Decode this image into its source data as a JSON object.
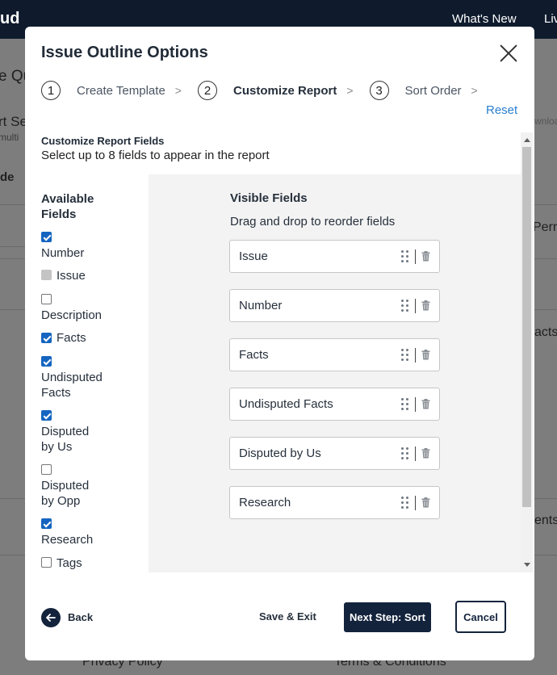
{
  "background": {
    "brand_fragment": "ud",
    "nav_whats_new": "What's New",
    "nav_fragment": "Liv",
    "fragments": [
      "e Qu",
      "rt Se",
      "multi",
      "de",
      "Perm",
      "acts,",
      "ents,",
      "wnloa",
      "Privacy Policy",
      "Terms & Conditions"
    ]
  },
  "modal": {
    "title": "Issue Outline Options",
    "steps": [
      {
        "number": "1",
        "label": "Create Template",
        "active": false
      },
      {
        "number": "2",
        "label": "Customize Report",
        "active": true
      },
      {
        "number": "3",
        "label": "Sort Order",
        "active": false
      }
    ],
    "step_separator": ">",
    "reset_label": "Reset",
    "section_title": "Customize Report Fields",
    "section_subtitle": "Select up to 8 fields to appear in the report",
    "available": {
      "heading": "Available Fields",
      "options": [
        {
          "label": "Number",
          "checked": true,
          "disabled": false
        },
        {
          "label": "Issue",
          "checked": true,
          "disabled": true
        },
        {
          "label": "Description",
          "checked": false,
          "disabled": false
        },
        {
          "label": "Facts",
          "checked": true,
          "disabled": false
        },
        {
          "label": "Undisputed Facts",
          "checked": true,
          "disabled": false
        },
        {
          "label": "Disputed by Us",
          "checked": true,
          "disabled": false
        },
        {
          "label": "Disputed by Opp",
          "checked": false,
          "disabled": false
        },
        {
          "label": "Research",
          "checked": true,
          "disabled": false
        },
        {
          "label": "Tags",
          "checked": false,
          "disabled": false
        }
      ]
    },
    "visible": {
      "heading": "Visible Fields",
      "subtitle": "Drag and drop to reorder fields",
      "fields": [
        "Issue",
        "Number",
        "Facts",
        "Undisputed Facts",
        "Disputed by Us",
        "Research"
      ]
    },
    "footer": {
      "back_label": "Back",
      "save_exit_label": "Save & Exit",
      "next_label": "Next Step: Sort",
      "cancel_label": "Cancel"
    }
  },
  "colors": {
    "navy": "#13233c",
    "link": "#2a80d0",
    "checkbox": "#1565c0",
    "overlay": "#7f7f7f"
  }
}
